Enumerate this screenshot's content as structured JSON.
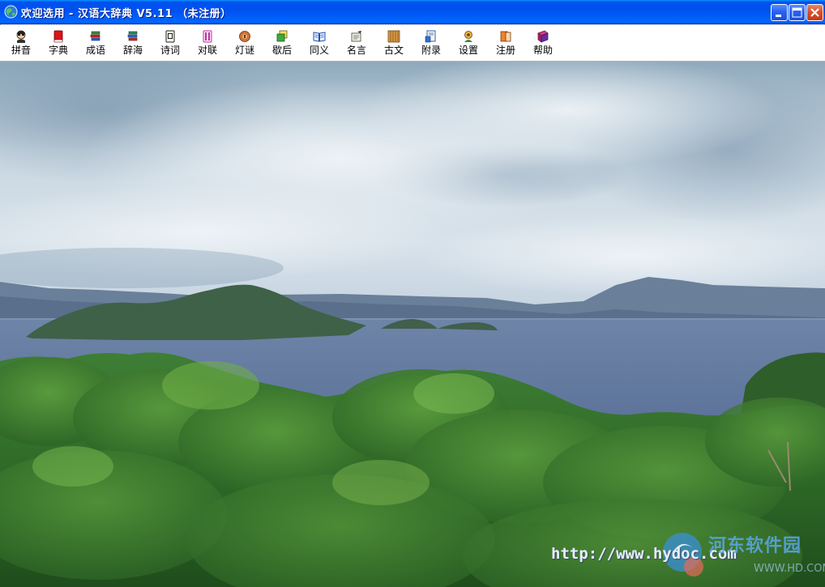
{
  "window": {
    "title": "欢迎选用 - 汉语大辞典 V5.11 （未注册）",
    "title_bar_color": "#0054E3",
    "close_button_color": "#D9532E"
  },
  "toolbar": {
    "items": [
      {
        "label": "拼音",
        "icon": "person-icon"
      },
      {
        "label": "字典",
        "icon": "red-book-icon"
      },
      {
        "label": "成语",
        "icon": "book-stack-icon"
      },
      {
        "label": "辞海",
        "icon": "book-stack-icon"
      },
      {
        "label": "诗词",
        "icon": "notebook-icon"
      },
      {
        "label": "对联",
        "icon": "scroll-icon"
      },
      {
        "label": "灯谜",
        "icon": "lantern-icon"
      },
      {
        "label": "歇后",
        "icon": "cards-icon"
      },
      {
        "label": "同义",
        "icon": "open-book-icon"
      },
      {
        "label": "名言",
        "icon": "pencil-note-icon"
      },
      {
        "label": "古文",
        "icon": "bamboo-slip-icon"
      },
      {
        "label": "附录",
        "icon": "document-icon"
      },
      {
        "label": "设置",
        "icon": "gear-person-icon"
      },
      {
        "label": "注册",
        "icon": "register-icon"
      },
      {
        "label": "帮助",
        "icon": "help-book-icon"
      }
    ]
  },
  "scene": {
    "description_icon": "landscape-image",
    "watermark_url": "http://www.hydoc.com",
    "watermark_site_name": "河东软件园",
    "watermark_site_sub": "WWW.HD.COM"
  }
}
